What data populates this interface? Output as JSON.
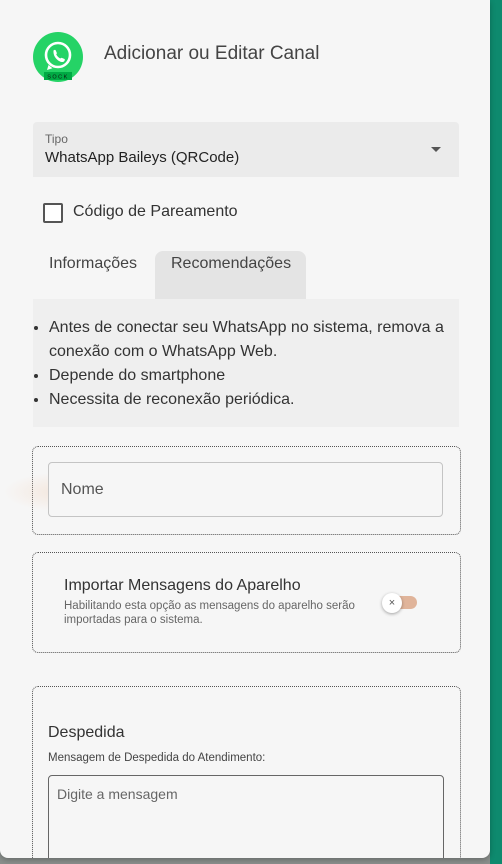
{
  "dialog": {
    "title": "Adicionar ou Editar Canal",
    "logo_badge": "SOCK",
    "logo_icon": "whatsapp-icon"
  },
  "tipo": {
    "label": "Tipo",
    "value": "WhatsApp Baileys (QRCode)"
  },
  "pairing_code": {
    "label": "Código de Pareamento",
    "checked": false
  },
  "tabs": [
    {
      "label": "Informações"
    },
    {
      "label": "Recomendações"
    }
  ],
  "info_items": [
    "Antes de conectar seu WhatsApp no sistema, remova a conexão com o WhatsApp Web.",
    "Depende do smartphone",
    "Necessita de reconexão periódica."
  ],
  "name_field": {
    "label": "Nome"
  },
  "import_messages": {
    "title": "Importar Mensagens do Aparelho",
    "description": "Habilitando esta opção as mensagens do aparelho serão importadas para o sistema.",
    "enabled": false,
    "knob_glyph": "×"
  },
  "farewell": {
    "title": "Despedida",
    "subtitle": "Mensagem de Despedida do Atendimento:",
    "placeholder": "Digite a mensagem"
  },
  "colors": {
    "whatsapp_green": "#25d366",
    "accent_teal": "#0e8a6e",
    "toggle_off": "#e0b49a"
  }
}
